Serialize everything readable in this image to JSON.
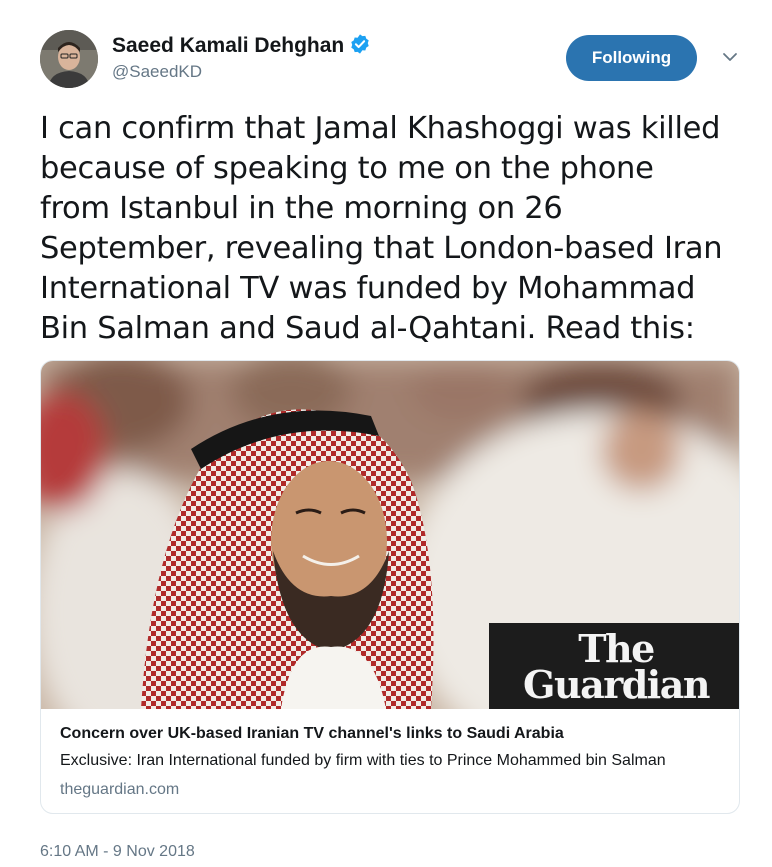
{
  "author": {
    "name": "Saeed Kamali Dehghan",
    "handle": "@SaeedKD",
    "verified": true
  },
  "follow_button": {
    "label": "Following"
  },
  "tweet": {
    "lines": [
      "I can confirm that Jamal Khashoggi was killed",
      "because of speaking to me on the phone",
      "from Istanbul in the morning on 26",
      "September, revealing that London-based Iran",
      "International TV was funded by Mohammad",
      "Bin Salman and Saud al-Qahtani. Read this:"
    ],
    "timestamp": "6:10 AM - 9 Nov 2018"
  },
  "card": {
    "logo_line1": "The",
    "logo_line2": "Guardian",
    "title": "Concern over UK-based Iranian TV channel's links to Saudi Arabia",
    "description": "Exclusive: Iran International funded by firm with ties to Prince Mohammed bin Salman",
    "domain": "theguardian.com"
  },
  "colors": {
    "follow_button": "#2b74b0",
    "verified_badge": "#1da1f2",
    "secondary_text": "#657786",
    "card_border": "#e1e8ed"
  },
  "icons": [
    "avatar",
    "verified-badge-icon",
    "chevron-down-icon"
  ]
}
